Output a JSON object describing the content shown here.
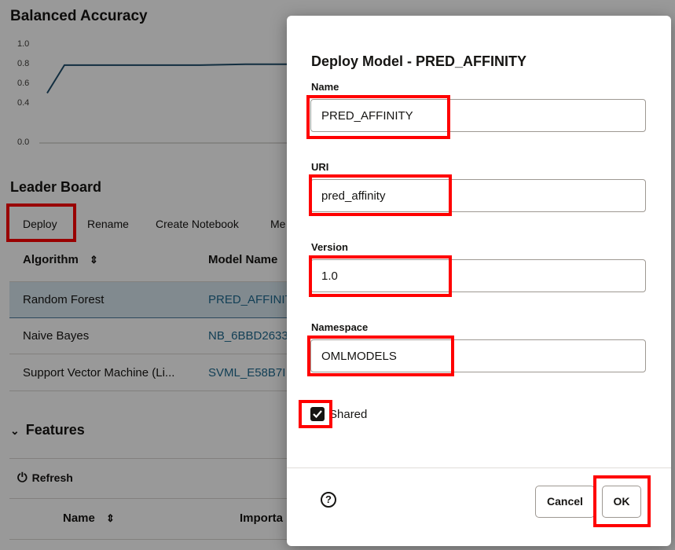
{
  "background": {
    "chart_title": "Balanced Accuracy",
    "chart_data": {
      "type": "line",
      "title": "Balanced Accuracy",
      "y_ticks": [
        "1.0",
        "0.8",
        "0.6",
        "0.4",
        "0.0"
      ],
      "ylim": [
        0.0,
        1.0
      ],
      "series": [
        {
          "values": [
            0.5,
            0.78,
            0.78,
            0.78,
            0.78,
            0.79,
            0.79
          ]
        }
      ]
    },
    "leaderboard_title": "Leader Board",
    "toolbar": {
      "deploy": "Deploy",
      "rename": "Rename",
      "create_notebook": "Create Notebook",
      "more": "Me"
    },
    "table": {
      "headers": {
        "algorithm": "Algorithm",
        "model_name": "Model Name"
      },
      "rows": [
        {
          "algorithm": "Random Forest",
          "model_name": "PRED_AFFINIT"
        },
        {
          "algorithm": "Naive Bayes",
          "model_name": "NB_6BBD2633"
        },
        {
          "algorithm": "Support Vector Machine (Li...",
          "model_name": "SVML_E58B7I"
        }
      ]
    },
    "features": {
      "title": "Features",
      "refresh": "Refresh",
      "headers": {
        "name": "Name",
        "importance": "Importa"
      }
    }
  },
  "dialog": {
    "title": "Deploy Model - PRED_AFFINITY",
    "fields": {
      "name": {
        "label": "Name",
        "value": "PRED_AFFINITY"
      },
      "uri": {
        "label": "URI",
        "value": "pred_affinity"
      },
      "version": {
        "label": "Version",
        "value": "1.0"
      },
      "namespace": {
        "label": "Namespace",
        "value": "OMLMODELS"
      }
    },
    "shared": {
      "label": "Shared",
      "checked": true
    },
    "help": "?",
    "cancel": "Cancel",
    "ok": "OK"
  },
  "colors": {
    "highlight": "#ff0000",
    "link": "#1e6a8f",
    "selected_row": "#d7e6ef"
  }
}
